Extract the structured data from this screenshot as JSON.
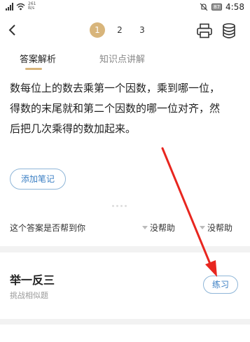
{
  "status_bar": {
    "speed_value": "261",
    "speed_unit": "B/s",
    "battery": "87",
    "time": "4:58"
  },
  "header": {
    "back_icon": "chevron-left-icon",
    "pages": [
      "1",
      "2",
      "3"
    ],
    "active_page": "1",
    "print_icon": "printer-icon",
    "stack_icon": "database-stack-icon",
    "accent_color": "#d8b57b"
  },
  "tabs": [
    {
      "label": "答案解析",
      "active": true
    },
    {
      "label": "知识点讲解",
      "active": false
    }
  ],
  "answer": {
    "lines": [
      "数每位上的数去乘第一个因数，乘到哪一位，",
      "得数的末尾就和第二个因数的哪一位对齐，然",
      "后把几次乘得的数加起来。"
    ]
  },
  "add_note_label": "添加笔记",
  "feedback": {
    "question": "这个答案是否帮到你",
    "option_1": "没帮助",
    "option_2": "没帮助"
  },
  "practice": {
    "title": "举一反三",
    "subtitle": "挑战相似题",
    "button_label": "练习",
    "button_color": "#3b7fc4"
  },
  "annotation": {
    "arrow_color": "#e8261f"
  }
}
